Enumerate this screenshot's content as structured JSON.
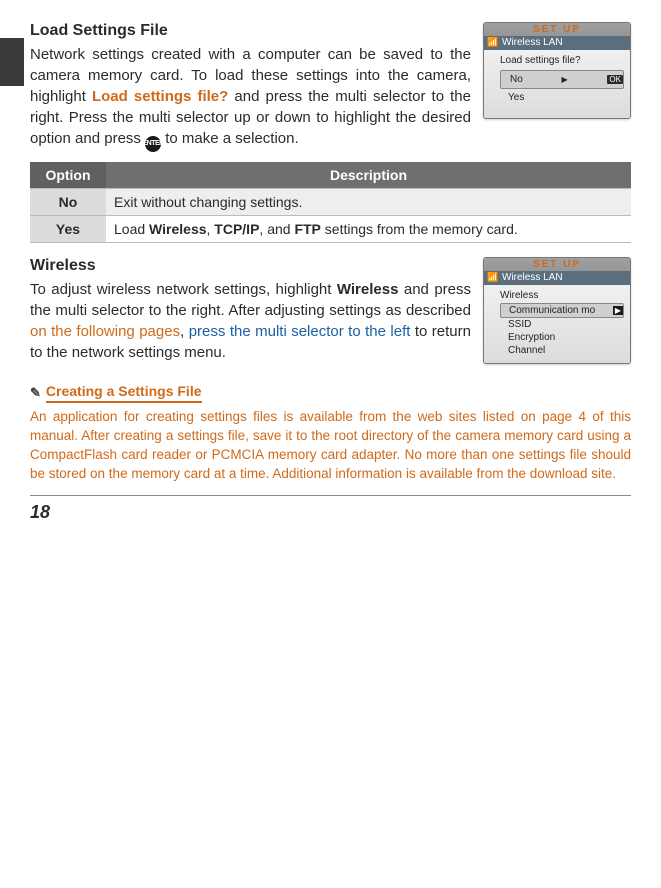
{
  "side_tab": "",
  "section1": {
    "heading": "Load Settings File",
    "paragraph_pre": "Network settings created with a computer can be saved to the camera memory card.  To load these settings into the camera, highlight ",
    "highlight": "Load settings file?",
    "paragraph_mid": " and press the multi selector to the right.  Press the multi selector up or down to highlight the desired option and press ",
    "paragraph_post": " to make a selection.",
    "enter_label": "ENTER",
    "screen": {
      "title": "SET  UP",
      "sub": "Wireless LAN",
      "question": "Load settings file?",
      "optNo": "No",
      "ok": "OK",
      "optYes": "Yes"
    }
  },
  "table": {
    "h1": "Option",
    "h2": "Description",
    "rows": [
      {
        "opt": "No",
        "desc_plain": "Exit without changing settings."
      },
      {
        "opt": "Yes",
        "desc_pre": "Load ",
        "b1": "Wireless",
        "sep1": ", ",
        "b2": "TCP/IP",
        "sep2": ", and ",
        "b3": "FTP",
        "desc_post": " settings from the memory card."
      }
    ]
  },
  "section2": {
    "heading": "Wireless",
    "p_pre": "To adjust wireless network settings, highlight ",
    "b1": "Wireless",
    "p_mid1": " and press the multi selector to the right.  After adjusting settings as described ",
    "orange": "on the following pages",
    "comma": ", ",
    "link": "press the multi selector to the left",
    "p_post": " to return to the network settings menu.",
    "screen": {
      "title": "SET  UP",
      "sub": "Wireless LAN",
      "subhead": "Wireless",
      "items": [
        "Communication mo",
        "SSID",
        "Encryption",
        "Channel"
      ]
    }
  },
  "note": {
    "heading": "Creating a Settings File",
    "body": "An application for creating settings files is available from the web sites listed on page 4 of this manual.  After creating a settings file, save it to the root directory of the camera memory card using a CompactFlash card reader or PCMCIA memory card adapter.  No more than one settings file should be stored on the memory card at a time.  Additional information is available from the download site."
  },
  "page_number": "18"
}
